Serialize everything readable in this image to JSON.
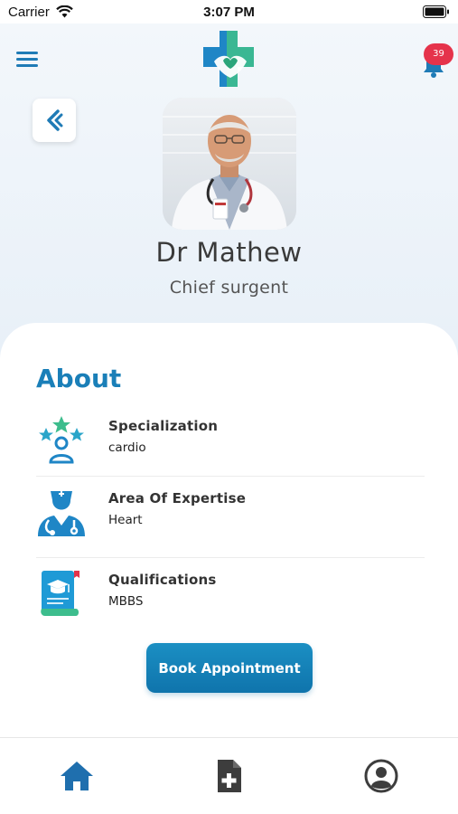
{
  "status_bar": {
    "carrier": "Carrier",
    "time": "3:07 PM"
  },
  "header": {
    "notification_count": "39"
  },
  "doctor": {
    "name": "Dr Mathew",
    "role": "Chief surgent"
  },
  "about": {
    "title": "About",
    "items": [
      {
        "label": "Specialization",
        "value": "cardio",
        "icon": "specialization-icon"
      },
      {
        "label": "Area Of Expertise",
        "value": "Heart",
        "icon": "doctor-icon"
      },
      {
        "label": "Qualifications",
        "value": "MBBS",
        "icon": "certificate-icon"
      }
    ]
  },
  "actions": {
    "book_label": "Book Appointment"
  },
  "tabs": [
    {
      "name": "home",
      "icon": "home-icon"
    },
    {
      "name": "add-record",
      "icon": "add-document-icon"
    },
    {
      "name": "profile",
      "icon": "profile-icon"
    }
  ],
  "colors": {
    "accent": "#1a7fb8",
    "badge": "#e5334b",
    "logo_green": "#3dbd8d"
  }
}
